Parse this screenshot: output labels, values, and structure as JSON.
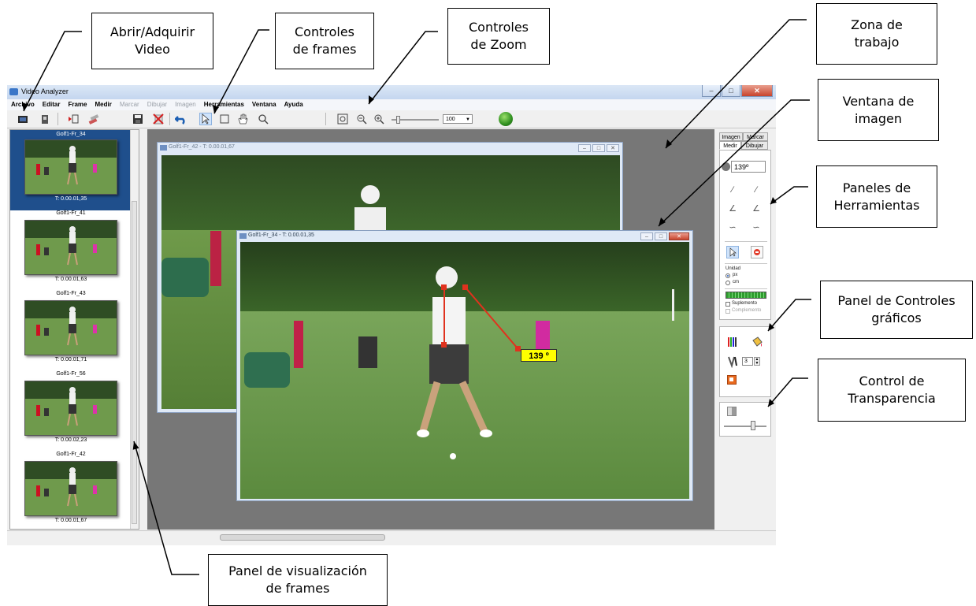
{
  "app": {
    "title": "Video Analyzer",
    "menu": [
      {
        "label": "Archivo",
        "enabled": true
      },
      {
        "label": "Editar",
        "enabled": true
      },
      {
        "label": "Frame",
        "enabled": true
      },
      {
        "label": "Medir",
        "enabled": true
      },
      {
        "label": "Marcar",
        "enabled": false
      },
      {
        "label": "Dibujar",
        "enabled": false
      },
      {
        "label": "Imagen",
        "enabled": false
      },
      {
        "label": "Herramientas",
        "enabled": true
      },
      {
        "label": "Ventana",
        "enabled": true
      },
      {
        "label": "Ayuda",
        "enabled": true
      }
    ],
    "toolbar": {
      "icons": [
        "open-video-icon",
        "acquire-video-icon",
        "play-frame-icon",
        "frames-icon",
        "save-icon",
        "delete-icon",
        "undo-icon",
        "pointer-icon",
        "rectangle-select-icon",
        "hand-pan-icon",
        "magnifier-icon",
        "zoom-fit-icon",
        "zoom-out-icon",
        "zoom-in-icon",
        "globe-icon"
      ],
      "zoom_value": "100"
    }
  },
  "frames_panel": {
    "items": [
      {
        "name": "Golf1-Fr_34",
        "time": "T: 0.00.01,35",
        "selected": true
      },
      {
        "name": "Golf1-Fr_41",
        "time": "T: 0.00.01,63",
        "selected": false
      },
      {
        "name": "Golf1-Fr_43",
        "time": "T: 0.00.01,71",
        "selected": false
      },
      {
        "name": "Golf1-Fr_56",
        "time": "T: 0.00.02,23",
        "selected": false
      },
      {
        "name": "Golf1-Fr_42",
        "time": "T: 0.00.01,67",
        "selected": false
      }
    ]
  },
  "windows": {
    "back": {
      "title": "Golf1-Fr_42 - T: 0.00.01,67"
    },
    "front": {
      "title": "Golf1-Fr_34 - T: 0.00.01,35",
      "angle_label": "139 º"
    }
  },
  "tool_panel": {
    "tabs": [
      "Imagen",
      "Marcar",
      "Medir",
      "Dibujar"
    ],
    "active_tab": "Medir",
    "angle_value": "139º",
    "unit_label": "Unidad",
    "units": [
      "px",
      "cm"
    ],
    "selected_unit": "px",
    "suplemento": "Suplemento",
    "complemento": "Complemento",
    "line_width": "3"
  },
  "callouts": {
    "abrir": "Abrir/Adquirir\nVideo",
    "frames": "Controles\nde frames",
    "zoom": "Controles\nde Zoom",
    "zona": "Zona de\ntrabajo",
    "ventana": "Ventana de\nimagen",
    "paneles": "Paneles de\nHerramientas",
    "graficos": "Panel de Controles\ngráficos",
    "transparencia": "Control de\nTransparencia",
    "visualizacion": "Panel de visualización\nde frames"
  },
  "colors": {
    "selected_frame": "#1f4f8c",
    "workspace": "#777777",
    "angle_line": "#e0321e",
    "angle_label_bg": "#ffff00"
  }
}
